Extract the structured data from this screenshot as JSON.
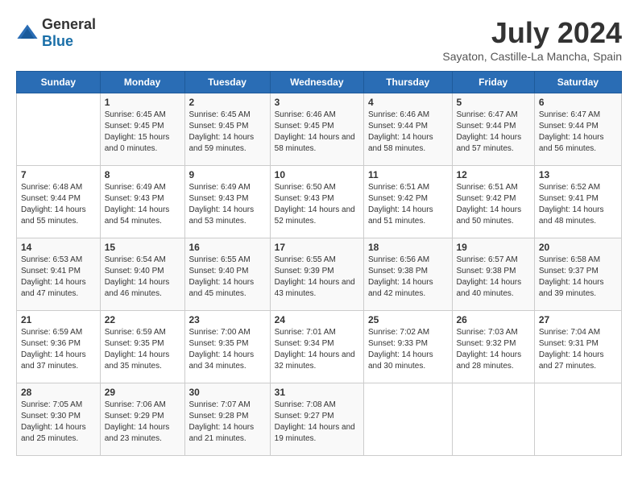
{
  "logo": {
    "general": "General",
    "blue": "Blue"
  },
  "title": "July 2024",
  "subtitle": "Sayaton, Castille-La Mancha, Spain",
  "days_header": [
    "Sunday",
    "Monday",
    "Tuesday",
    "Wednesday",
    "Thursday",
    "Friday",
    "Saturday"
  ],
  "weeks": [
    [
      {
        "day": "",
        "sunrise": "",
        "sunset": "",
        "daylight": ""
      },
      {
        "day": "1",
        "sunrise": "Sunrise: 6:45 AM",
        "sunset": "Sunset: 9:45 PM",
        "daylight": "Daylight: 15 hours and 0 minutes."
      },
      {
        "day": "2",
        "sunrise": "Sunrise: 6:45 AM",
        "sunset": "Sunset: 9:45 PM",
        "daylight": "Daylight: 14 hours and 59 minutes."
      },
      {
        "day": "3",
        "sunrise": "Sunrise: 6:46 AM",
        "sunset": "Sunset: 9:45 PM",
        "daylight": "Daylight: 14 hours and 58 minutes."
      },
      {
        "day": "4",
        "sunrise": "Sunrise: 6:46 AM",
        "sunset": "Sunset: 9:44 PM",
        "daylight": "Daylight: 14 hours and 58 minutes."
      },
      {
        "day": "5",
        "sunrise": "Sunrise: 6:47 AM",
        "sunset": "Sunset: 9:44 PM",
        "daylight": "Daylight: 14 hours and 57 minutes."
      },
      {
        "day": "6",
        "sunrise": "Sunrise: 6:47 AM",
        "sunset": "Sunset: 9:44 PM",
        "daylight": "Daylight: 14 hours and 56 minutes."
      }
    ],
    [
      {
        "day": "7",
        "sunrise": "Sunrise: 6:48 AM",
        "sunset": "Sunset: 9:44 PM",
        "daylight": "Daylight: 14 hours and 55 minutes."
      },
      {
        "day": "8",
        "sunrise": "Sunrise: 6:49 AM",
        "sunset": "Sunset: 9:43 PM",
        "daylight": "Daylight: 14 hours and 54 minutes."
      },
      {
        "day": "9",
        "sunrise": "Sunrise: 6:49 AM",
        "sunset": "Sunset: 9:43 PM",
        "daylight": "Daylight: 14 hours and 53 minutes."
      },
      {
        "day": "10",
        "sunrise": "Sunrise: 6:50 AM",
        "sunset": "Sunset: 9:43 PM",
        "daylight": "Daylight: 14 hours and 52 minutes."
      },
      {
        "day": "11",
        "sunrise": "Sunrise: 6:51 AM",
        "sunset": "Sunset: 9:42 PM",
        "daylight": "Daylight: 14 hours and 51 minutes."
      },
      {
        "day": "12",
        "sunrise": "Sunrise: 6:51 AM",
        "sunset": "Sunset: 9:42 PM",
        "daylight": "Daylight: 14 hours and 50 minutes."
      },
      {
        "day": "13",
        "sunrise": "Sunrise: 6:52 AM",
        "sunset": "Sunset: 9:41 PM",
        "daylight": "Daylight: 14 hours and 48 minutes."
      }
    ],
    [
      {
        "day": "14",
        "sunrise": "Sunrise: 6:53 AM",
        "sunset": "Sunset: 9:41 PM",
        "daylight": "Daylight: 14 hours and 47 minutes."
      },
      {
        "day": "15",
        "sunrise": "Sunrise: 6:54 AM",
        "sunset": "Sunset: 9:40 PM",
        "daylight": "Daylight: 14 hours and 46 minutes."
      },
      {
        "day": "16",
        "sunrise": "Sunrise: 6:55 AM",
        "sunset": "Sunset: 9:40 PM",
        "daylight": "Daylight: 14 hours and 45 minutes."
      },
      {
        "day": "17",
        "sunrise": "Sunrise: 6:55 AM",
        "sunset": "Sunset: 9:39 PM",
        "daylight": "Daylight: 14 hours and 43 minutes."
      },
      {
        "day": "18",
        "sunrise": "Sunrise: 6:56 AM",
        "sunset": "Sunset: 9:38 PM",
        "daylight": "Daylight: 14 hours and 42 minutes."
      },
      {
        "day": "19",
        "sunrise": "Sunrise: 6:57 AM",
        "sunset": "Sunset: 9:38 PM",
        "daylight": "Daylight: 14 hours and 40 minutes."
      },
      {
        "day": "20",
        "sunrise": "Sunrise: 6:58 AM",
        "sunset": "Sunset: 9:37 PM",
        "daylight": "Daylight: 14 hours and 39 minutes."
      }
    ],
    [
      {
        "day": "21",
        "sunrise": "Sunrise: 6:59 AM",
        "sunset": "Sunset: 9:36 PM",
        "daylight": "Daylight: 14 hours and 37 minutes."
      },
      {
        "day": "22",
        "sunrise": "Sunrise: 6:59 AM",
        "sunset": "Sunset: 9:35 PM",
        "daylight": "Daylight: 14 hours and 35 minutes."
      },
      {
        "day": "23",
        "sunrise": "Sunrise: 7:00 AM",
        "sunset": "Sunset: 9:35 PM",
        "daylight": "Daylight: 14 hours and 34 minutes."
      },
      {
        "day": "24",
        "sunrise": "Sunrise: 7:01 AM",
        "sunset": "Sunset: 9:34 PM",
        "daylight": "Daylight: 14 hours and 32 minutes."
      },
      {
        "day": "25",
        "sunrise": "Sunrise: 7:02 AM",
        "sunset": "Sunset: 9:33 PM",
        "daylight": "Daylight: 14 hours and 30 minutes."
      },
      {
        "day": "26",
        "sunrise": "Sunrise: 7:03 AM",
        "sunset": "Sunset: 9:32 PM",
        "daylight": "Daylight: 14 hours and 28 minutes."
      },
      {
        "day": "27",
        "sunrise": "Sunrise: 7:04 AM",
        "sunset": "Sunset: 9:31 PM",
        "daylight": "Daylight: 14 hours and 27 minutes."
      }
    ],
    [
      {
        "day": "28",
        "sunrise": "Sunrise: 7:05 AM",
        "sunset": "Sunset: 9:30 PM",
        "daylight": "Daylight: 14 hours and 25 minutes."
      },
      {
        "day": "29",
        "sunrise": "Sunrise: 7:06 AM",
        "sunset": "Sunset: 9:29 PM",
        "daylight": "Daylight: 14 hours and 23 minutes."
      },
      {
        "day": "30",
        "sunrise": "Sunrise: 7:07 AM",
        "sunset": "Sunset: 9:28 PM",
        "daylight": "Daylight: 14 hours and 21 minutes."
      },
      {
        "day": "31",
        "sunrise": "Sunrise: 7:08 AM",
        "sunset": "Sunset: 9:27 PM",
        "daylight": "Daylight: 14 hours and 19 minutes."
      },
      {
        "day": "",
        "sunrise": "",
        "sunset": "",
        "daylight": ""
      },
      {
        "day": "",
        "sunrise": "",
        "sunset": "",
        "daylight": ""
      },
      {
        "day": "",
        "sunrise": "",
        "sunset": "",
        "daylight": ""
      }
    ]
  ]
}
